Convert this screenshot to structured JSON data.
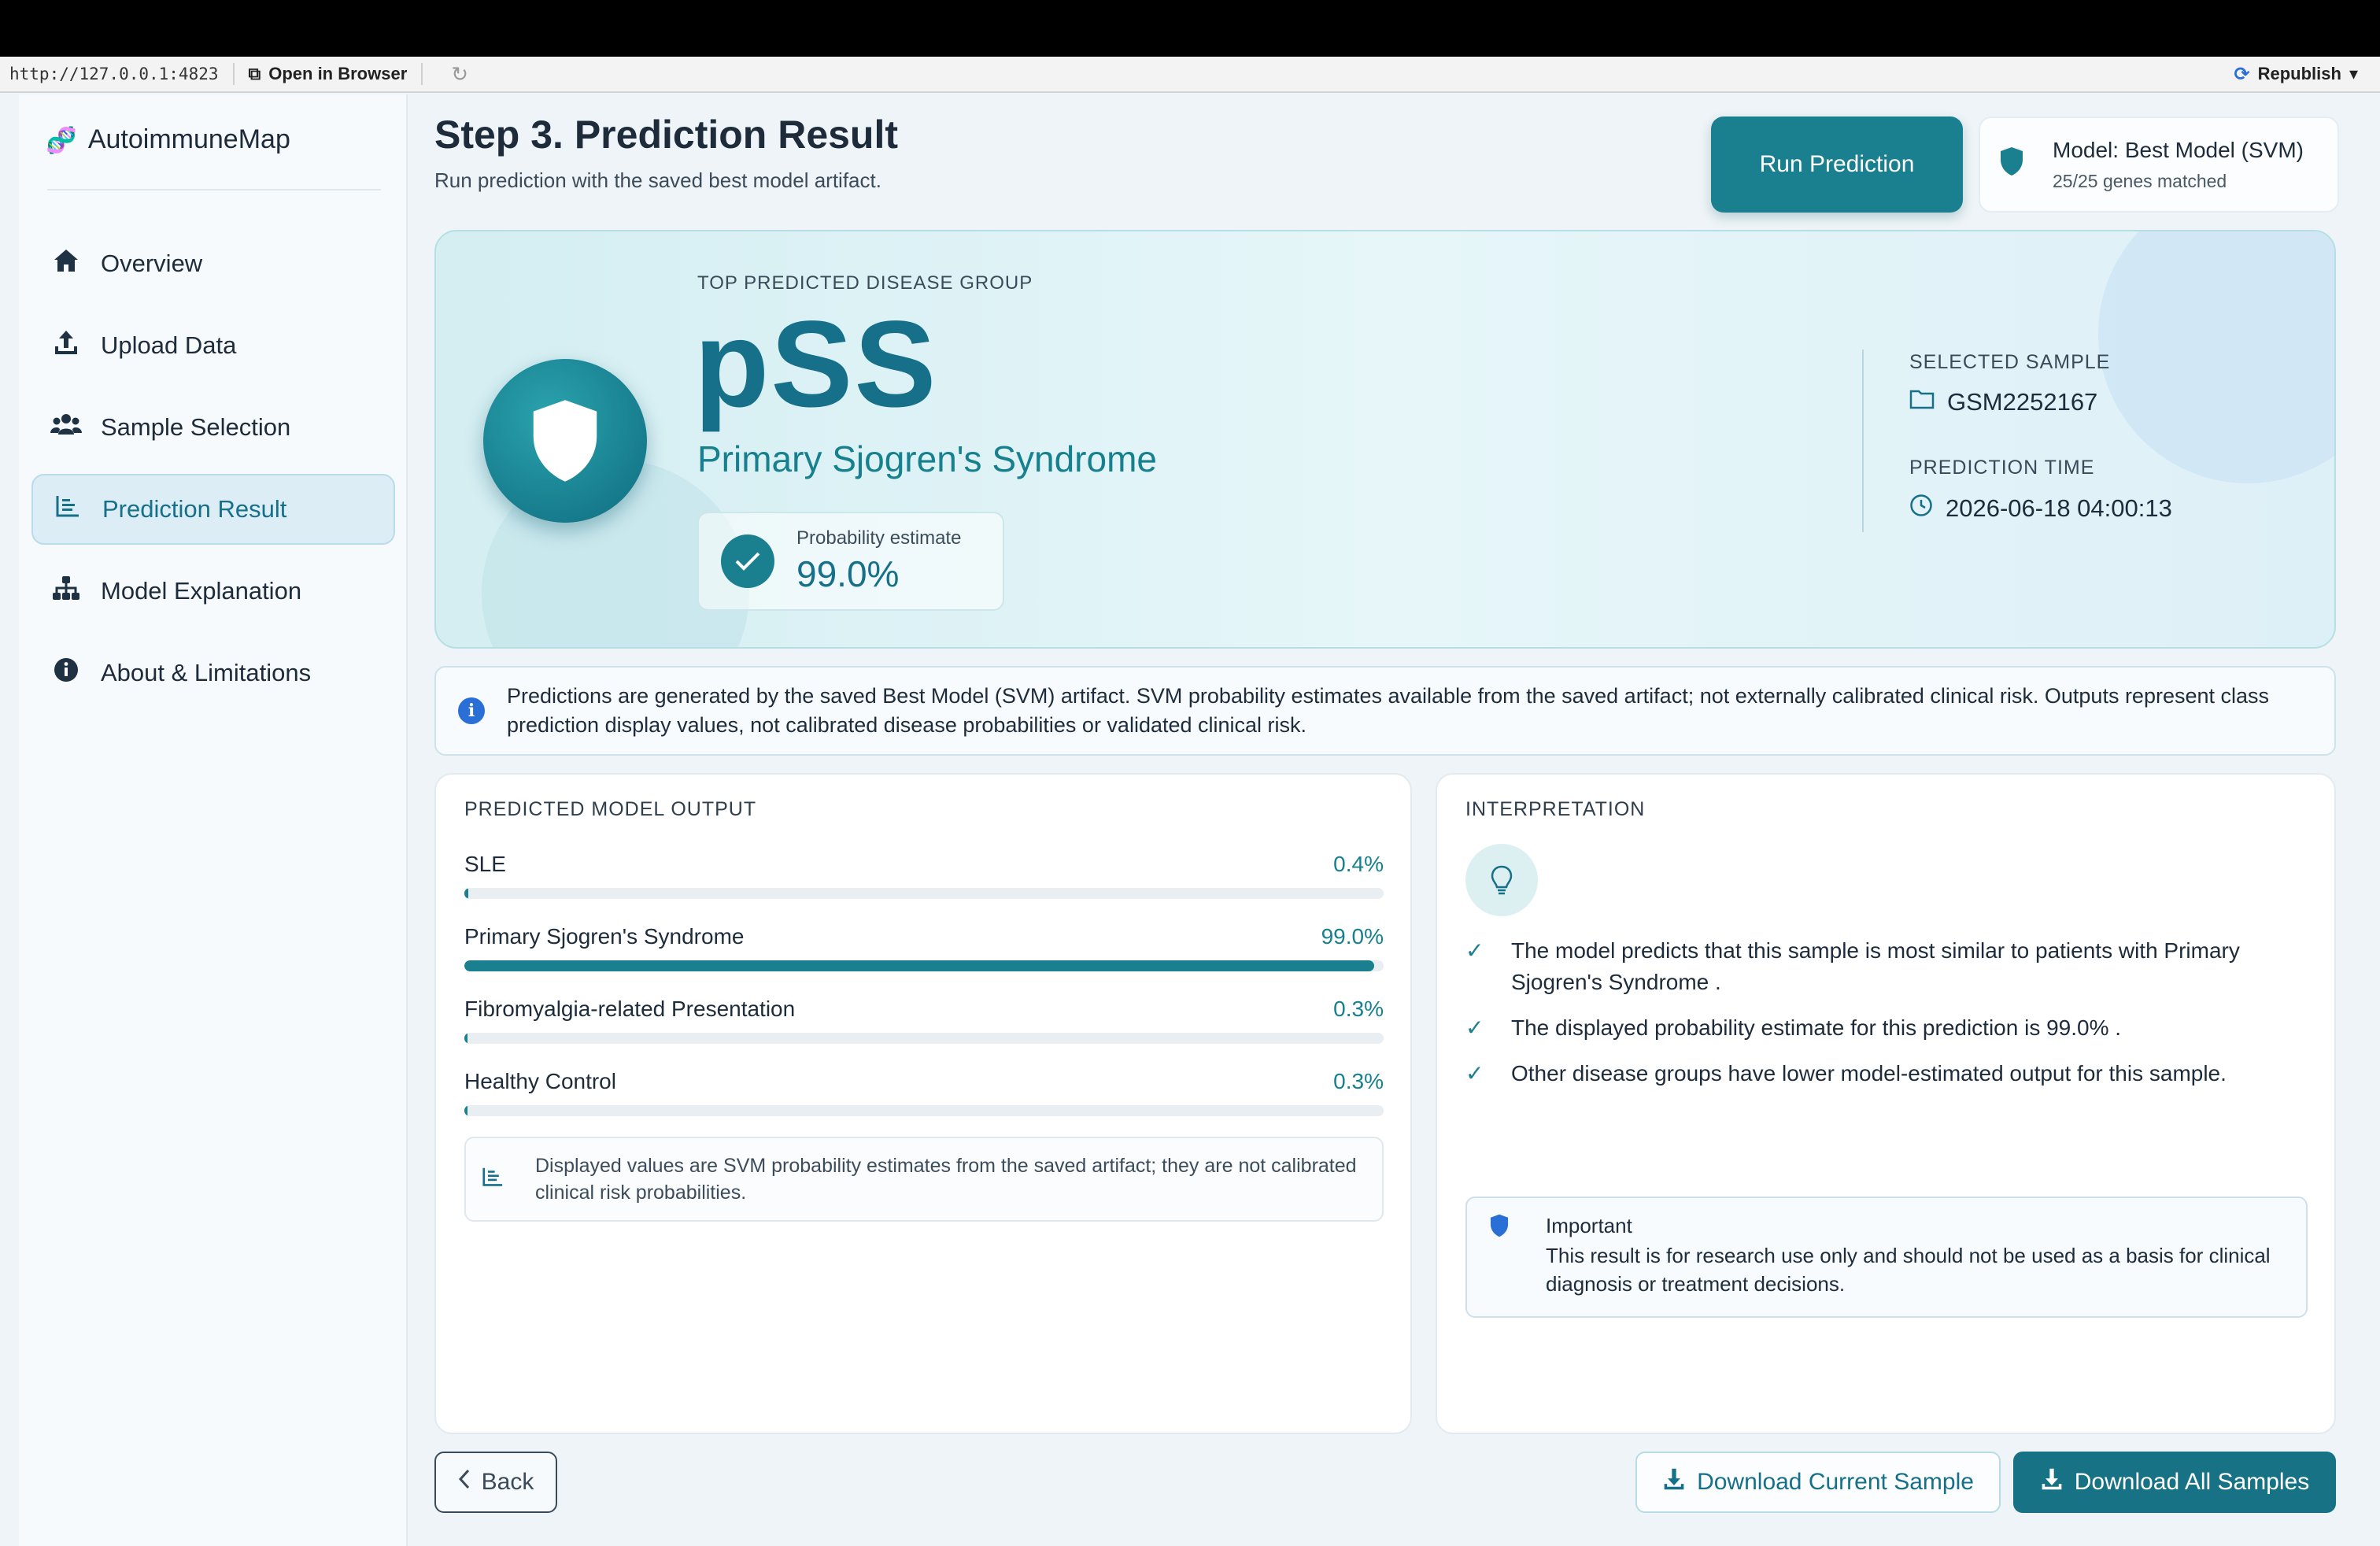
{
  "browser": {
    "url": "http://127.0.0.1:4823",
    "open_in_browser": "Open in Browser",
    "republish": "Republish"
  },
  "sidebar": {
    "brand": "AutoimmuneMap",
    "items": [
      {
        "label": "Overview",
        "icon": "home-icon"
      },
      {
        "label": "Upload Data",
        "icon": "upload-icon"
      },
      {
        "label": "Sample Selection",
        "icon": "users-icon"
      },
      {
        "label": "Prediction Result",
        "icon": "chart-icon",
        "active": true
      },
      {
        "label": "Model Explanation",
        "icon": "hierarchy-icon"
      },
      {
        "label": "About & Limitations",
        "icon": "info-icon"
      }
    ]
  },
  "header": {
    "title": "Step 3. Prediction Result",
    "subtitle": "Run prediction with the saved best model artifact.",
    "run_button": "Run Prediction",
    "model_name": "Model: Best Model (SVM)",
    "genes_matched": "25/25 genes matched"
  },
  "hero": {
    "eyebrow": "TOP PREDICTED DISEASE GROUP",
    "abbrev": "pSS",
    "full_name": "Primary Sjogren's Syndrome",
    "prob_label": "Probability estimate",
    "prob_value": "99.0%",
    "selected_sample_label": "SELECTED SAMPLE",
    "selected_sample": "GSM2252167",
    "prediction_time_label": "PREDICTION TIME",
    "prediction_time": "2026-06-18 04:00:13"
  },
  "notice": {
    "text": "Predictions are generated by the saved Best Model (SVM) artifact. SVM probability estimates available from the saved artifact; not externally calibrated clinical risk. Outputs represent class prediction display values, not calibrated disease probabilities or validated clinical risk."
  },
  "output_panel": {
    "title": "PREDICTED MODEL OUTPUT",
    "rows": [
      {
        "label": "SLE",
        "pct": "0.4%",
        "value": 0.4
      },
      {
        "label": "Primary Sjogren's Syndrome",
        "pct": "99.0%",
        "value": 99.0
      },
      {
        "label": "Fibromyalgia-related Presentation",
        "pct": "0.3%",
        "value": 0.3
      },
      {
        "label": "Healthy Control",
        "pct": "0.3%",
        "value": 0.3
      }
    ],
    "note": "Displayed values are SVM probability estimates from the saved artifact; they are not calibrated clinical risk probabilities."
  },
  "interpretation": {
    "title": "INTERPRETATION",
    "items": [
      "The model predicts that this sample is most similar to patients with Primary Sjogren's Syndrome .",
      "The displayed probability estimate for this prediction is 99.0% .",
      "Other disease groups have lower model-estimated output for this sample."
    ],
    "important_title": "Important",
    "important_text": "This result is for research use only and should not be used as a basis for clinical diagnosis or treatment decisions."
  },
  "footer": {
    "back": "Back",
    "download_current": "Download Current Sample",
    "download_all": "Download All Samples"
  },
  "colors": {
    "accent": "#1a7f8e",
    "active_nav_bg": "#dcedf6",
    "info_blue": "#2a6fd6"
  }
}
